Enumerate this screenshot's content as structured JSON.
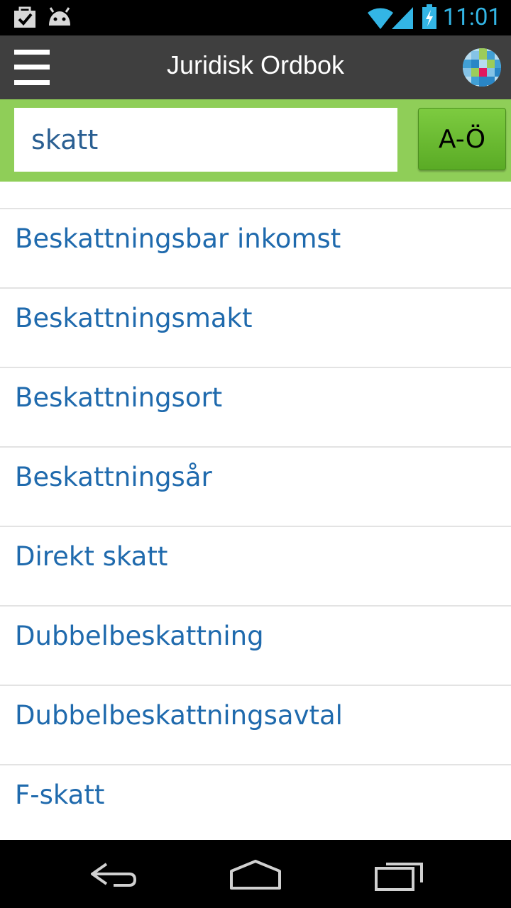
{
  "status_bar": {
    "time": "11:01",
    "icons": [
      "task-check-icon",
      "android-icon",
      "wifi-icon",
      "signal-icon",
      "battery-charging-icon"
    ],
    "accent_color": "#33b5e5"
  },
  "app_bar": {
    "title": "Juridisk Ordbok",
    "menu_icon": "hamburger-menu-icon",
    "logo_icon": "publisher-logo-icon",
    "background_color": "#3f3f3f"
  },
  "search": {
    "value": "skatt",
    "az_label": "A-Ö",
    "band_color": "#8fce58"
  },
  "results": [
    {
      "label": "Beskattningsbar inkomst"
    },
    {
      "label": "Beskattningsmakt"
    },
    {
      "label": "Beskattningsort"
    },
    {
      "label": "Beskattningsår"
    },
    {
      "label": "Direkt skatt"
    },
    {
      "label": "Dubbelbeskattning"
    },
    {
      "label": "Dubbelbeskattningsavtal"
    },
    {
      "label": "F-skatt"
    }
  ],
  "nav_bar": {
    "icons": [
      "back-icon",
      "home-icon",
      "recent-apps-icon"
    ]
  }
}
